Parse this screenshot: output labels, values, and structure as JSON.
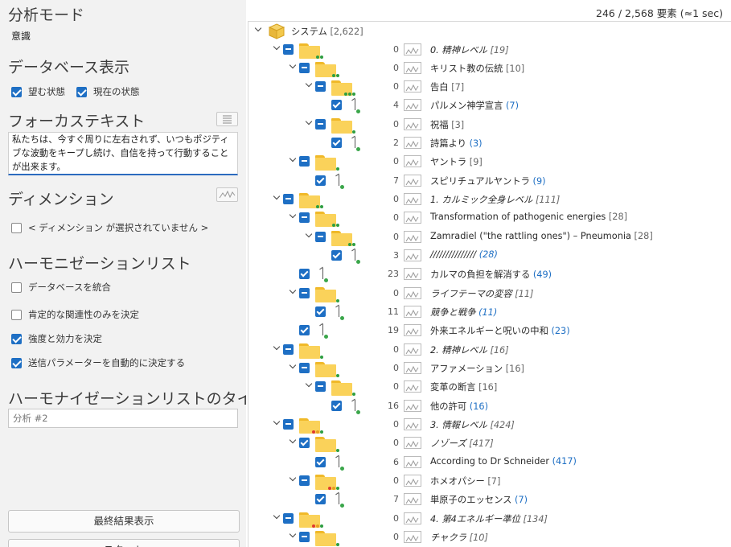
{
  "left": {
    "analysis_mode_title": "分析モード",
    "analysis_mode_value": "意識",
    "database_view_title": "データベース表示",
    "desired_state_label": "望む状態",
    "current_state_label": "現在の状態",
    "focus_text_title": "フォーカステキスト",
    "focus_text_value": "私たちは、今すぐ周りに左右されず、いつもポジティブな波動をキープし続け、自信を持って行動することが出来ます。",
    "dimension_title": "ディメンション",
    "dimension_none_label": "< ディメンション が選択されていません >",
    "harmonization_list_title": "ハーモニゼーションリスト",
    "merge_db_label": "データベースを統合",
    "positive_only_label": "肯定的な関連性のみを決定",
    "strength_label": "強度と効力を決定",
    "auto_params_label": "送信パラメーターを自動的に決定する",
    "list_title_heading": "ハーモナイゼーションリストのタイトル",
    "list_title_value": "分析 #2",
    "final_results_button": "最終結果表示",
    "start_button": "スタート"
  },
  "checkbox_states": {
    "desired": true,
    "current": true,
    "dimension_none": false,
    "merge_db": false,
    "positive_only": false,
    "strength": true,
    "auto_params": true
  },
  "status": "246 / 2,568 要素 (≈1 sec)",
  "tree_root": {
    "label": "システム",
    "count": "[2,622]"
  },
  "tree_rows": [
    {
      "level": 1,
      "kind": "folder",
      "cb": "part",
      "value": "0",
      "label": "0. 精神レベル",
      "italic": true,
      "count": "[19]",
      "count_color": "gray",
      "dots": [
        "#2e9e40",
        "#2e9e40"
      ]
    },
    {
      "level": 2,
      "kind": "folder",
      "cb": "part",
      "value": "0",
      "label": "キリスト教の伝統",
      "italic": false,
      "count": "[10]",
      "count_color": "gray",
      "dots": [
        "#2e9e40",
        "#2e9e40"
      ]
    },
    {
      "level": 3,
      "kind": "folder",
      "cb": "part",
      "value": "0",
      "label": "告白",
      "italic": false,
      "count": "[7]",
      "count_color": "gray",
      "dots": [
        "#2e9e40",
        "#2e9e40",
        "#2e9e40"
      ]
    },
    {
      "level": 4,
      "kind": "leaf",
      "cb": "chk",
      "value": "4",
      "label": "パルメン神学宣言",
      "italic": false,
      "count": "(7)",
      "count_color": "blue",
      "dots": []
    },
    {
      "level": 3,
      "kind": "folder",
      "cb": "part",
      "value": "0",
      "label": "祝福",
      "italic": false,
      "count": "[3]",
      "count_color": "gray",
      "dots": [
        "#2e9e40"
      ]
    },
    {
      "level": 4,
      "kind": "leaf",
      "cb": "chk",
      "value": "2",
      "label": "詩篇より",
      "italic": false,
      "count": "(3)",
      "count_color": "blue",
      "dots": []
    },
    {
      "level": 2,
      "kind": "folder",
      "cb": "part",
      "value": "0",
      "label": "ヤントラ",
      "italic": false,
      "count": "[9]",
      "count_color": "gray",
      "dots": [
        "#2e9e40"
      ]
    },
    {
      "level": 3,
      "kind": "leaf",
      "cb": "chk",
      "value": "7",
      "label": "スピリチュアルヤントラ",
      "italic": false,
      "count": "(9)",
      "count_color": "blue",
      "dots": []
    },
    {
      "level": 1,
      "kind": "folder",
      "cb": "part",
      "value": "0",
      "label": "1. カルミック全身レベル",
      "italic": true,
      "count": "[111]",
      "count_color": "gray",
      "dots": [
        "#2e9e40",
        "#2e9e40"
      ]
    },
    {
      "level": 2,
      "kind": "folder",
      "cb": "part",
      "value": "0",
      "label": "Transformation of pathogenic energies",
      "italic": false,
      "count": "[28]",
      "count_color": "gray",
      "dots": [
        "#2e9e40",
        "#2e9e40"
      ]
    },
    {
      "level": 3,
      "kind": "folder",
      "cb": "part",
      "value": "0",
      "label": "Zamradiel (\"the rattling ones\") – Pneumonia",
      "italic": false,
      "count": "[28]",
      "count_color": "gray",
      "dots": [
        "#2e9e40",
        "#2e9e40"
      ]
    },
    {
      "level": 4,
      "kind": "leaf",
      "cb": "chk",
      "value": "3",
      "label": "///////////////",
      "italic": true,
      "count": "(28)",
      "count_color": "blue",
      "dots": []
    },
    {
      "level": 2,
      "kind": "leaf",
      "cb": "chk",
      "value": "23",
      "label": "カルマの負担を解消する",
      "italic": false,
      "count": "(49)",
      "count_color": "blue",
      "dots": []
    },
    {
      "level": 2,
      "kind": "folder",
      "cb": "part",
      "value": "0",
      "label": "ライフテーマの変容",
      "italic": true,
      "count": "[11]",
      "count_color": "gray",
      "dots": [
        "#2e9e40"
      ]
    },
    {
      "level": 3,
      "kind": "leaf",
      "cb": "chk",
      "value": "11",
      "label": "競争と戦争",
      "italic": true,
      "count": "(11)",
      "count_color": "blue",
      "dots": []
    },
    {
      "level": 2,
      "kind": "leaf",
      "cb": "chk",
      "value": "19",
      "label": "外来エネルギーと呪いの中和",
      "italic": false,
      "count": "(23)",
      "count_color": "blue",
      "dots": []
    },
    {
      "level": 1,
      "kind": "folder",
      "cb": "part",
      "value": "0",
      "label": "2. 精神レベル",
      "italic": true,
      "count": "[16]",
      "count_color": "gray",
      "dots": [
        "#2e9e40"
      ]
    },
    {
      "level": 2,
      "kind": "folder",
      "cb": "part",
      "value": "0",
      "label": "アファメーション",
      "italic": false,
      "count": "[16]",
      "count_color": "gray",
      "dots": [
        "#2e9e40"
      ]
    },
    {
      "level": 3,
      "kind": "folder",
      "cb": "part",
      "value": "0",
      "label": "変革の断言",
      "italic": false,
      "count": "[16]",
      "count_color": "gray",
      "dots": [
        "#2e9e40"
      ]
    },
    {
      "level": 4,
      "kind": "leaf",
      "cb": "chk",
      "value": "16",
      "label": "他の許可",
      "italic": false,
      "count": "(16)",
      "count_color": "blue",
      "dots": []
    },
    {
      "level": 1,
      "kind": "folder",
      "cb": "part",
      "value": "0",
      "label": "3. 情報レベル",
      "italic": true,
      "count": "[424]",
      "count_color": "gray",
      "dots": [
        "#e03a2e",
        "#e8a020",
        "#2e9e40"
      ]
    },
    {
      "level": 2,
      "kind": "folder",
      "cb": "chk",
      "value": "0",
      "label": "ノゾーズ",
      "italic": true,
      "count": "[417]",
      "count_color": "gray",
      "dots": [
        "#2e9e40"
      ]
    },
    {
      "level": 3,
      "kind": "leaf",
      "cb": "chk",
      "value": "6",
      "label": "According to Dr Schneider",
      "italic": false,
      "count": "(417)",
      "count_color": "blue",
      "dots": []
    },
    {
      "level": 2,
      "kind": "folder",
      "cb": "part",
      "value": "0",
      "label": "ホメオパシー",
      "italic": false,
      "count": "[7]",
      "count_color": "gray",
      "dots": [
        "#e03a2e",
        "#e8a020",
        "#2e9e40"
      ]
    },
    {
      "level": 3,
      "kind": "leaf",
      "cb": "chk",
      "value": "7",
      "label": "単原子のエッセンス",
      "italic": false,
      "count": "(7)",
      "count_color": "blue",
      "dots": []
    },
    {
      "level": 1,
      "kind": "folder",
      "cb": "part",
      "value": "0",
      "label": "4. 第4エネルギー準位",
      "italic": true,
      "count": "[134]",
      "count_color": "gray",
      "dots": [
        "#e03a2e",
        "#e8a020",
        "#2e9e40"
      ]
    },
    {
      "level": 2,
      "kind": "folder",
      "cb": "part",
      "value": "0",
      "label": "チャクラ",
      "italic": true,
      "count": "[10]",
      "count_color": "gray",
      "dots": [
        "#2e9e40"
      ]
    }
  ],
  "colors": {
    "accent": "#1e6fc4",
    "folder": "#fad25a",
    "panel": "#f2f2f2"
  },
  "icons": {
    "expander": "chevron-down-icon",
    "graph": "waveform-icon",
    "list": "list-icon"
  }
}
